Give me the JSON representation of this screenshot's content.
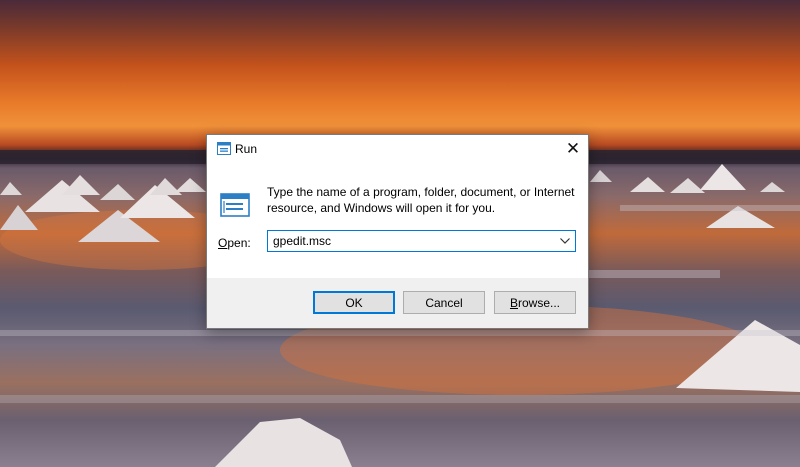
{
  "dialog": {
    "title": "Run",
    "close_glyph": "✕",
    "description": "Type the name of a program, folder, document, or Internet resource, and Windows will open it for you.",
    "open_label_accel": "O",
    "open_label_rest": "pen:",
    "input_value": "gpedit.msc",
    "buttons": {
      "ok": "OK",
      "cancel": "Cancel",
      "browse_accel": "B",
      "browse_rest": "rowse..."
    },
    "icons": {
      "title": "run-app-icon",
      "large": "run-app-icon",
      "dropdown": "chevron-down-icon",
      "close": "close-icon"
    },
    "accent_color": "#0078d7"
  },
  "desktop": {
    "wallpaper": "sunset-salt-flats-photo"
  }
}
